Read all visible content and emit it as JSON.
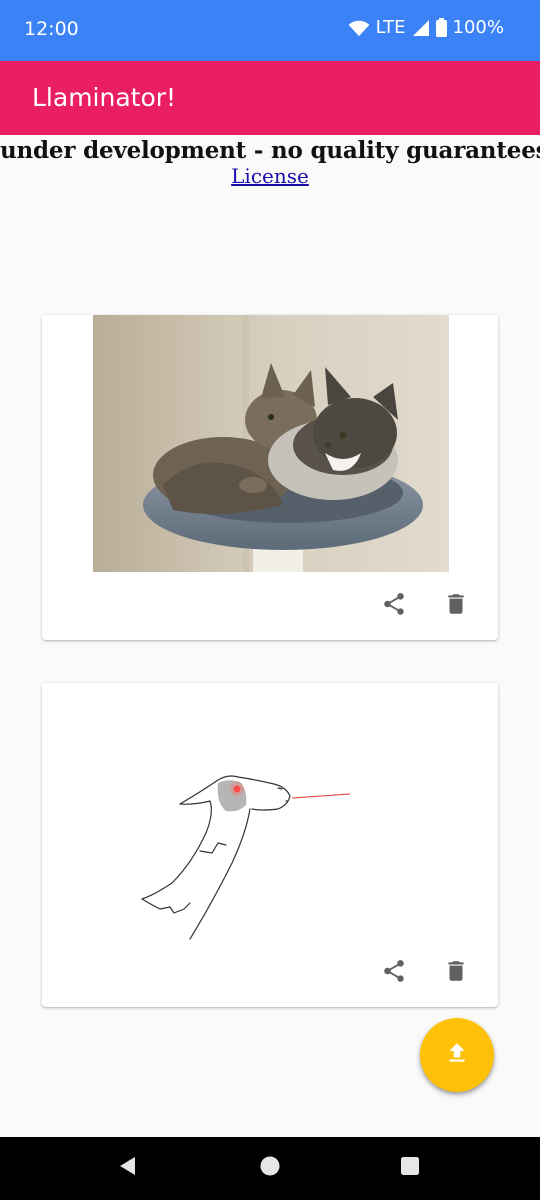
{
  "status_bar": {
    "time": "12:00",
    "network": "LTE",
    "battery": "100%",
    "icons": [
      "wifi-icon",
      "cell-signal-icon",
      "battery-icon"
    ]
  },
  "app_bar": {
    "title": "Llaminator!"
  },
  "notice": {
    "text": "under development - no quality guarantees",
    "license_link": "License"
  },
  "cards": [
    {
      "image": "photo of two tabby cats in a grey cat bed",
      "actions": [
        "share-icon",
        "delete-icon"
      ]
    },
    {
      "image": "line drawing of a llama with red laser eye",
      "actions": [
        "share-icon",
        "delete-icon"
      ]
    }
  ],
  "fab": {
    "icon": "upload-icon"
  },
  "nav_bar": {
    "icons": [
      "back-icon",
      "home-icon",
      "recents-icon"
    ]
  },
  "colors": {
    "status_bar": "#3b82f6",
    "app_bar": "#e91e63",
    "fab": "#ffc107",
    "link": "#1a0dab"
  }
}
